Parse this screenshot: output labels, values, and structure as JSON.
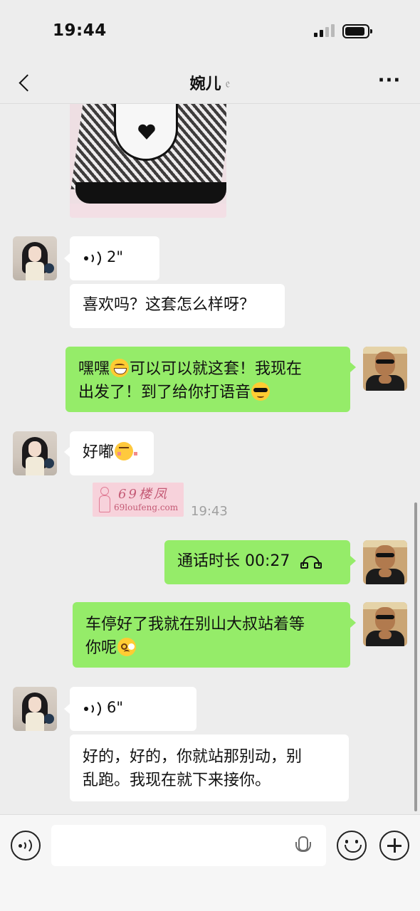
{
  "status_bar": {
    "time": "19:44"
  },
  "header": {
    "title": "婉儿",
    "ear_symbol": "ℰ",
    "more_label": "···"
  },
  "messages": [
    {
      "type": "image",
      "from": "contact"
    },
    {
      "type": "voice",
      "from": "contact",
      "duration": "2\""
    },
    {
      "type": "text",
      "from": "contact",
      "text": "喜欢吗？这套怎么样呀？"
    },
    {
      "type": "text",
      "from": "me",
      "text_a": "嘿嘿",
      "text_b": "可以可以就这套！我现在",
      "text_c": "出发了！到了给你打语音",
      "emojis": [
        "grinning-face",
        "sunglasses-face"
      ]
    },
    {
      "type": "text",
      "from": "contact",
      "text": "好嘟",
      "emojis": [
        "shy-face"
      ]
    },
    {
      "type": "call",
      "from": "me",
      "text": "通话时长 00:27",
      "icon": "phone-hangup-icon"
    },
    {
      "type": "text",
      "from": "me",
      "text_a": "车停好了我就在别山大叔站着等",
      "text_b": "你呢",
      "emojis": [
        "flushed-face"
      ]
    },
    {
      "type": "voice",
      "from": "contact",
      "duration": "6\""
    },
    {
      "type": "text",
      "from": "contact",
      "text_a": "好的，好的，你就站那别动，别",
      "text_b": "乱跑。我现在就下来接你。"
    }
  ],
  "watermark": {
    "title": "69楼凤",
    "url": "69loufeng.com"
  },
  "timestamp": "19:43",
  "input_bar": {
    "placeholder": "",
    "icons": [
      "voice-toggle-icon",
      "microphone-icon",
      "emoji-icon",
      "plus-icon"
    ]
  },
  "colors": {
    "background": "#ededed",
    "outgoing_bubble": "#95ec69",
    "incoming_bubble": "#ffffff",
    "timestamp": "#a0a0a0"
  }
}
